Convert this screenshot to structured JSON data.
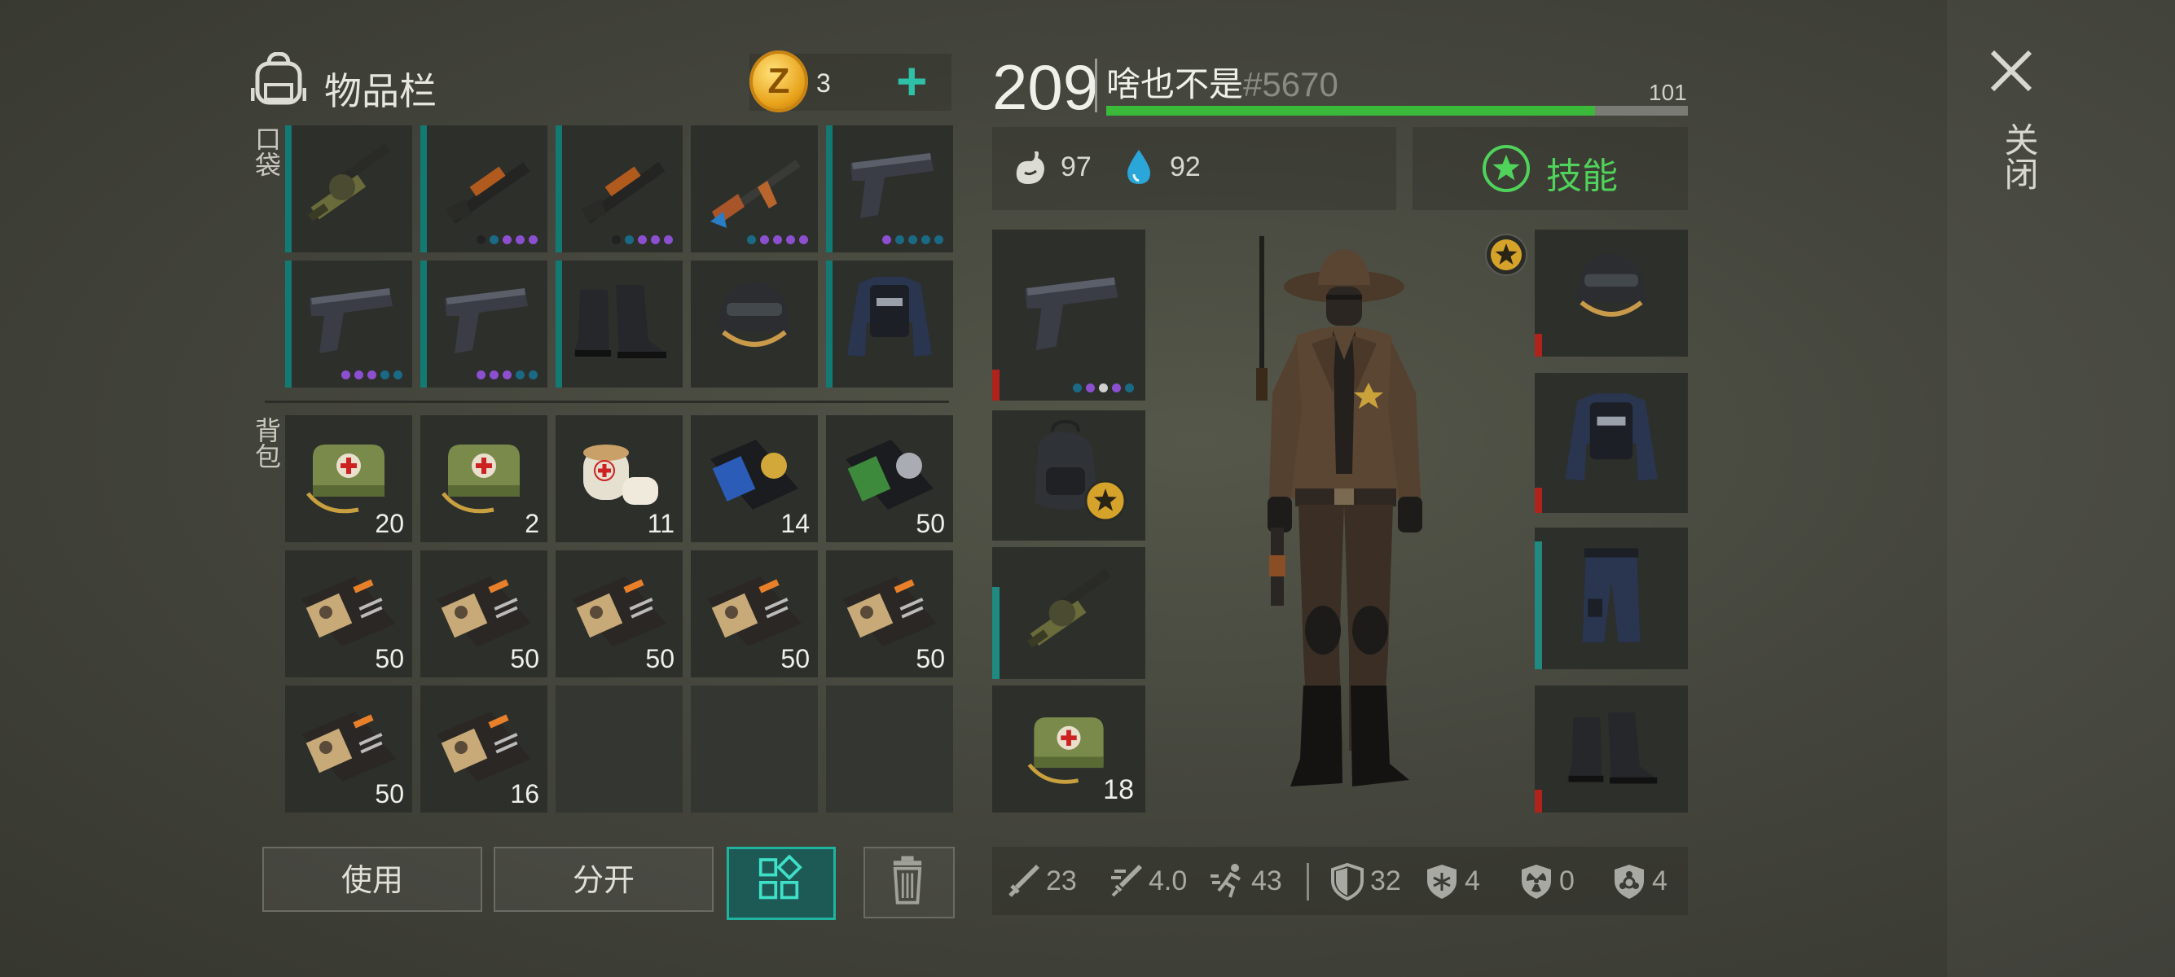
{
  "inventory": {
    "title": "物品栏",
    "currency": {
      "amount": "3",
      "add": "+"
    },
    "pocket_label": "口袋",
    "backpack_label": "背包",
    "pocket_items": [
      {
        "name": "grenade-launcher",
        "qty": "",
        "bar": "#127a73",
        "dots": []
      },
      {
        "name": "pump-shotgun",
        "qty": "",
        "bar": "#127a73",
        "dots": [
          "#222",
          "#1a6a86",
          "#8c4fd0",
          "#8c4fd0",
          "#8c4fd0"
        ]
      },
      {
        "name": "shotgun",
        "qty": "",
        "bar": "#127a73",
        "dots": [
          "#222",
          "#1a6a86",
          "#8c4fd0",
          "#8c4fd0",
          "#8c4fd0"
        ]
      },
      {
        "name": "assault-rifle",
        "qty": "",
        "bar": "",
        "dots": [
          "#1a6a86",
          "#8c4fd0",
          "#8c4fd0",
          "#8c4fd0",
          "#8c4fd0"
        ]
      },
      {
        "name": "pistol",
        "qty": "",
        "bar": "#127a73",
        "dots": [
          "#8c4fd0",
          "#1a6a86",
          "#1a6a86",
          "#1a6a86",
          "#1a6a86"
        ]
      },
      {
        "name": "pistol",
        "qty": "",
        "bar": "#127a73",
        "dots": [
          "#8c4fd0",
          "#8c4fd0",
          "#8c4fd0",
          "#1a6a86",
          "#1a6a86"
        ]
      },
      {
        "name": "pistol",
        "qty": "",
        "bar": "#127a73",
        "dots": [
          "#8c4fd0",
          "#8c4fd0",
          "#8c4fd0",
          "#1a6a86",
          "#1a6a86"
        ]
      },
      {
        "name": "boots",
        "qty": "",
        "bar": "#127a73",
        "dots": []
      },
      {
        "name": "helmet",
        "qty": "",
        "bar": "",
        "dots": []
      },
      {
        "name": "police-vest",
        "qty": "",
        "bar": "#127a73",
        "dots": []
      }
    ],
    "backpack_items": [
      {
        "name": "medkit",
        "qty": "20"
      },
      {
        "name": "medkit",
        "qty": "2"
      },
      {
        "name": "bandage",
        "qty": "11"
      },
      {
        "name": "badge-blue",
        "qty": "14"
      },
      {
        "name": "badge-green",
        "qty": "50"
      },
      {
        "name": "patrol-id",
        "qty": "50"
      },
      {
        "name": "patrol-id",
        "qty": "50"
      },
      {
        "name": "patrol-id",
        "qty": "50"
      },
      {
        "name": "patrol-id",
        "qty": "50"
      },
      {
        "name": "patrol-id",
        "qty": "50"
      },
      {
        "name": "patrol-id",
        "qty": "50"
      },
      {
        "name": "patrol-id",
        "qty": "16"
      },
      {
        "name": "empty",
        "qty": ""
      },
      {
        "name": "empty",
        "qty": ""
      },
      {
        "name": "empty",
        "qty": ""
      }
    ],
    "buttons": {
      "use": "使用",
      "split": "分开"
    }
  },
  "player": {
    "level": "209",
    "name": "啥也不是",
    "tag": "#5670",
    "xp_value": "101",
    "xp_fraction": 0.84,
    "food": "97",
    "water": "92",
    "skills_label": "技能"
  },
  "equipment": {
    "left": [
      {
        "name": "pistol",
        "qty": "",
        "bar": "#b0221c",
        "bar_fraction": 0.18,
        "dots": [
          "#1a6a86",
          "#8c4fd0",
          "#cfcfcf",
          "#8c4fd0",
          "#1a6a86"
        ]
      },
      {
        "name": "backpack",
        "qty": "",
        "bar": "",
        "bar_fraction": 0,
        "dots": []
      },
      {
        "name": "grenade-launcher",
        "qty": "",
        "bar": "#1f8a80",
        "bar_fraction": 0.7,
        "dots": []
      },
      {
        "name": "medkit",
        "qty": "18",
        "bar": "",
        "bar_fraction": 0,
        "dots": []
      }
    ],
    "right": [
      {
        "name": "helmet",
        "bar": "#b0221c",
        "bar_fraction": 0.18
      },
      {
        "name": "police-vest",
        "bar": "#b0221c",
        "bar_fraction": 0.18
      },
      {
        "name": "police-pants",
        "bar": "#1f8a80",
        "bar_fraction": 0.9
      },
      {
        "name": "boots",
        "bar": "#b0221c",
        "bar_fraction": 0.18
      }
    ]
  },
  "stats": {
    "damage": "23",
    "attack_speed": "4.0",
    "speed": "43",
    "defense": "32",
    "cold": "4",
    "radiation": "0",
    "infection": "4"
  },
  "close_label": "关闭",
  "colors": {
    "accent": "#1fb3a0",
    "xp": "#3ab93a",
    "skill": "#4fd35a",
    "durability_low": "#b0221c"
  }
}
